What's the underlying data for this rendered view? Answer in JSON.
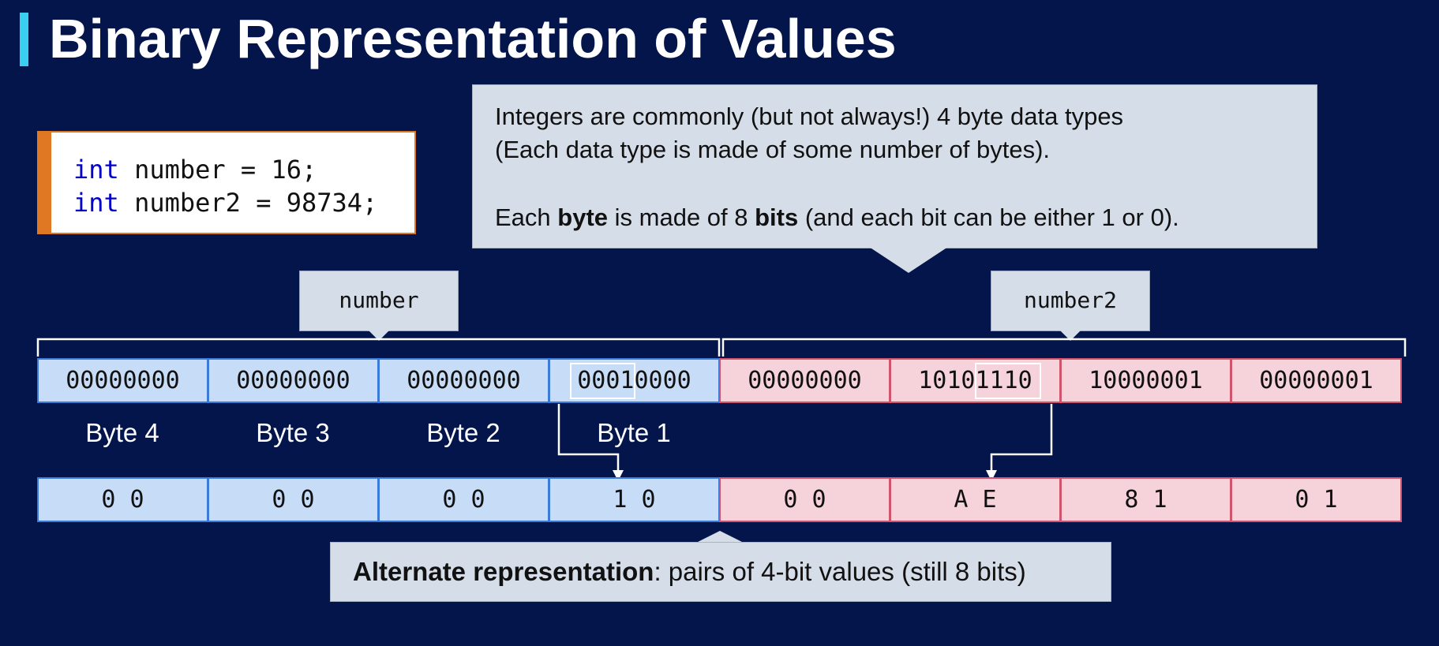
{
  "title": "Binary Representation of Values",
  "code": {
    "line1": {
      "keyword": "int",
      "rest": " number = 16;"
    },
    "line2": {
      "keyword": "int",
      "rest": " number2 = 98734;"
    }
  },
  "callout": {
    "line1": "Integers are commonly (but not always!) 4 byte data types",
    "line2": "(Each data type is made of some number of bytes).",
    "line3": {
      "part1": "Each ",
      "bold1": "byte",
      "part2": " is made of 8 ",
      "bold2": "bits",
      "part3": " (and each bit can be either 1 or 0)."
    }
  },
  "labels": {
    "number": "number",
    "number2": "number2"
  },
  "number": {
    "bytes": [
      "00000000",
      "00000000",
      "00000000",
      "00010000"
    ],
    "hex": [
      "0 0",
      "0 0",
      "0 0",
      "1 0"
    ]
  },
  "number2": {
    "bytes": [
      "00000000",
      "10101110",
      "10000001",
      "00000001"
    ],
    "hex": [
      "0 0",
      "A E",
      "8 1",
      "0 1"
    ]
  },
  "byte_labels": [
    "Byte 4",
    "Byte 3",
    "Byte 2",
    "Byte 1"
  ],
  "alt_note": {
    "bold": "Alternate representation",
    "rest": ": pairs of 4-bit values (still 8 bits)"
  },
  "colors": {
    "background": "#03154a",
    "accent_cyan": "#38d0ee",
    "accent_orange": "#e07722",
    "number_fill": "#c6dcf7",
    "number2_fill": "#f6d3da"
  }
}
